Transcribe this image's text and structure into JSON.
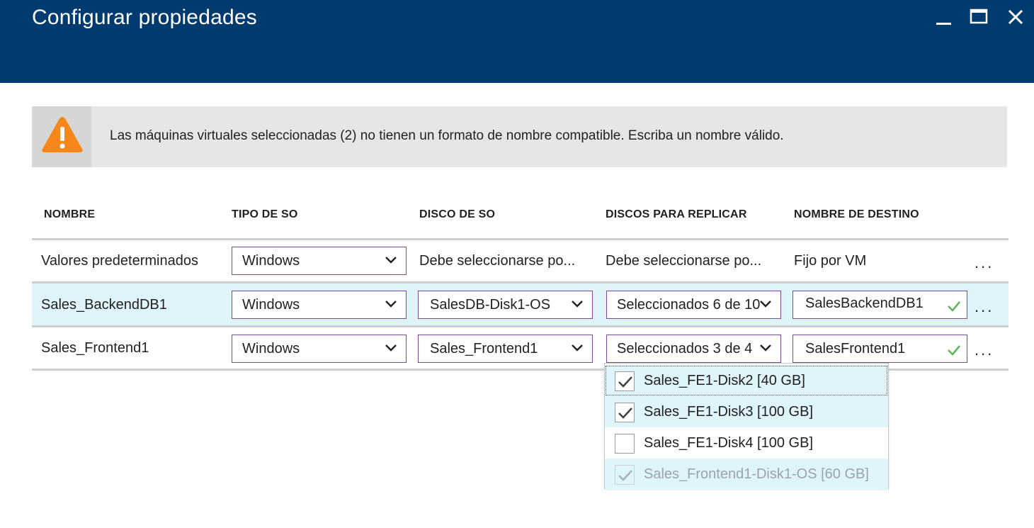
{
  "window": {
    "title": "Configurar propiedades",
    "controls": [
      "minimize-icon",
      "maximize-icon",
      "close-icon"
    ]
  },
  "warning": {
    "icon": "warning-icon",
    "message": "Las máquinas virtuales seleccionadas (2) no tienen un formato de nombre compatible. Escriba un nombre válido."
  },
  "table": {
    "headers": {
      "name": "NOMBRE",
      "os_type": "TIPO DE SO",
      "os_disk": "DISCO DE SO",
      "disks": "DISCOS PARA REPLICAR",
      "target": "NOMBRE DE DESTINO"
    },
    "defaults": {
      "name": "Valores predeterminados",
      "os_type": "Windows",
      "os_disk": "Debe seleccionarse po...",
      "disks": "Debe seleccionarse po...",
      "target": "Fijo por VM",
      "more": "..."
    },
    "row1": {
      "name": "Sales_BackendDB1",
      "os_type": "Windows",
      "os_disk": "SalesDB-Disk1-OS",
      "disks": "Seleccionados 6 de 10",
      "target": "SalesBackendDB1",
      "more": "..."
    },
    "row2": {
      "name": "Sales_Frontend1",
      "os_type": "Windows",
      "os_disk": "Sales_Frontend1",
      "disks": "Seleccionados 3 de 4",
      "target": "SalesFrontend1",
      "more": "..."
    }
  },
  "disk_menu": {
    "options": [
      {
        "label": "Sales_FE1-Disk2 [40 GB]",
        "checked": true,
        "disabled": false
      },
      {
        "label": "Sales_FE1-Disk3 [100 GB]",
        "checked": true,
        "disabled": false
      },
      {
        "label": "Sales_FE1-Disk4 [100 GB]",
        "checked": false,
        "disabled": false
      },
      {
        "label": "Sales_Frontend1-Disk1-OS [60 GB]",
        "checked": true,
        "disabled": true
      }
    ]
  },
  "colors": {
    "titlebar": "#003b6f",
    "warning": "#f7871a",
    "selected_row": "#dff4fb",
    "field_border": "#7a4a9c",
    "valid_check": "#5cb85c"
  }
}
